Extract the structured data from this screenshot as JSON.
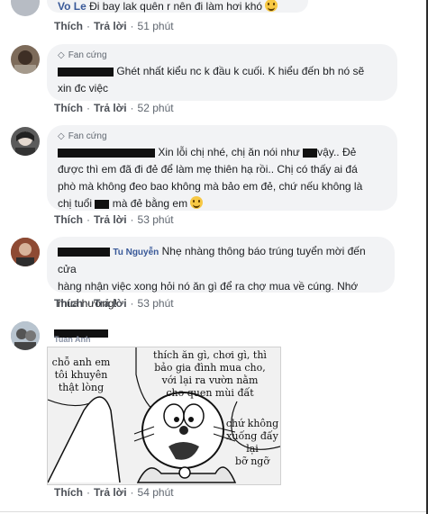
{
  "top_comment": {
    "name": "Vo Le",
    "text": "Đi bay lak quên r nên đi làm hơi khó",
    "like": "Thích",
    "reply": "Trả lời",
    "time": "51 phút"
  },
  "comments": [
    {
      "badge": "Fan cứng",
      "text_line1": "Ghét nhất kiểu nc k đầu k cuối. K hiểu đến bh nó sẽ",
      "text_line2": "xin đc việc",
      "like": "Thích",
      "reply": "Trả lời",
      "time": "52 phút"
    },
    {
      "badge": "Fan cứng",
      "line1_a": "Xin lỗi chị nhé, chị ăn nói như",
      "line1_b": "vậy.. Đẻ",
      "line2": "được thì em đã đi đẻ để làm mẹ thiên hạ rồi.. Chị có thấy ai đá",
      "line3": "phò mà không đeo bao không mà bảo em đẻ, chứ nếu không là",
      "line4_a": "chị tuổi",
      "line4_b": "mà đẻ bằng em",
      "like": "Thích",
      "reply": "Trả lời",
      "time": "53 phút"
    },
    {
      "name_fragment": "Tu Nguyễn",
      "line1": "Nhẹ nhàng thông báo trúng tuyển mời đến cửa",
      "line2": "hàng nhận việc xong hỏi nó ăn gì để ra chợ mua về cúng. Nhớ",
      "line3": "mua hương!",
      "like": "Thích",
      "reply": "Trả lời",
      "time": "53 phút"
    },
    {
      "name_fragment": "Tuan Anh",
      "comic": {
        "left_bubble": [
          "chỗ anh em",
          "tôi khuyên",
          "thật lòng"
        ],
        "top_bubble": [
          "thích ăn gì, chơi gì, thì",
          "bảo gia đình mua cho,",
          "với lại ra vườn nằm",
          "cho quen mùi đất"
        ],
        "right_bubble": [
          "chứ không",
          "xuống đấy lại",
          "bỡ ngỡ"
        ]
      },
      "like": "Thích",
      "reply": "Trả lời",
      "time": "54 phút"
    }
  ],
  "colors": {
    "link": "#385898",
    "bubble": "#f2f3f5",
    "meta": "#606770"
  }
}
